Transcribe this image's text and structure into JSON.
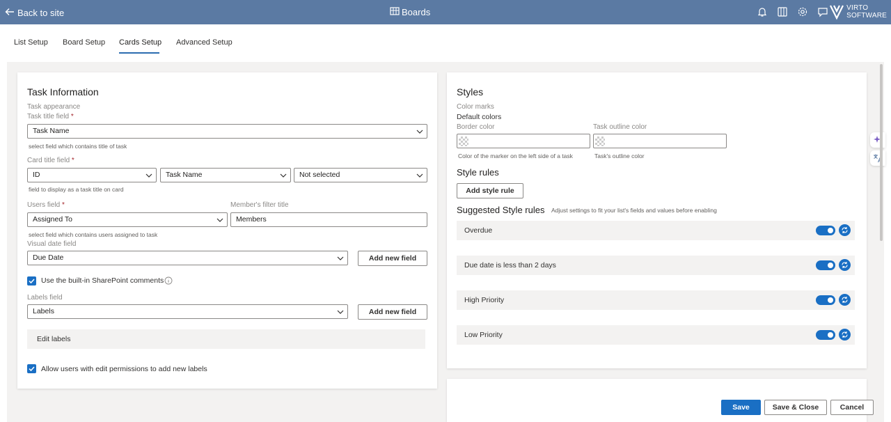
{
  "topbar": {
    "back_label": "Back to site",
    "app_title": "Boards",
    "logo_line1": "VIRTO",
    "logo_line2": "SOFTWARE",
    "icons": [
      "bell-icon",
      "book-icon",
      "gear-icon",
      "chat-icon"
    ]
  },
  "tabs": [
    {
      "label": "List Setup"
    },
    {
      "label": "Board Setup"
    },
    {
      "label": "Cards Setup",
      "active": true
    },
    {
      "label": "Advanced Setup"
    }
  ],
  "task_info": {
    "title": "Task Information",
    "section_label": "Task appearance",
    "task_title_field": {
      "label": "Task title field",
      "required": "*",
      "value": "Task Name",
      "hint": "select field which contains title of task"
    },
    "card_title_field": {
      "label": "Card title field",
      "required": "*",
      "values": [
        "ID",
        "Task Name",
        "Not selected"
      ],
      "hint": "field to display as a task title on card"
    },
    "users_field": {
      "label": "Users field",
      "required": "*",
      "value": "Assigned To",
      "hint": "select field which contains users assigned to task"
    },
    "member_filter": {
      "label": "Member's filter title",
      "value": "Members"
    },
    "visual_date_field": {
      "label": "Visual date field",
      "value": "Due Date",
      "add_button": "Add new field"
    },
    "sharepoint_comments": {
      "label": "Use the built-in SharePoint comments",
      "checked": true
    },
    "labels_field": {
      "label": "Labels field",
      "value": "Labels",
      "add_button": "Add new field"
    },
    "edit_labels": "Edit labels",
    "allow_new_labels": {
      "label": "Allow users with edit permissions to add new labels",
      "checked": true
    }
  },
  "styles": {
    "title": "Styles",
    "color_marks_label": "Color marks",
    "default_colors": "Default colors",
    "border_color": {
      "label": "Border color",
      "hint": "Color of the marker on the left side of a task"
    },
    "outline_color": {
      "label": "Task outline color",
      "hint": "Task's outline color"
    },
    "style_rules_title": "Style rules",
    "add_style_rule": "Add style rule",
    "suggested_title": "Suggested Style rules",
    "suggested_hint": "Adjust settings to fit your list's fields and values before enabling",
    "rules": [
      {
        "label": "Overdue",
        "enabled": true
      },
      {
        "label": "Due date is less than 2 days",
        "enabled": true
      },
      {
        "label": "High Priority",
        "enabled": true
      },
      {
        "label": "Low Priority",
        "enabled": true
      }
    ]
  },
  "footer": {
    "save": "Save",
    "save_close": "Save & Close",
    "cancel": "Cancel"
  },
  "colors": {
    "topbar": "#5b7aa3",
    "accent": "#1a6fc4"
  }
}
